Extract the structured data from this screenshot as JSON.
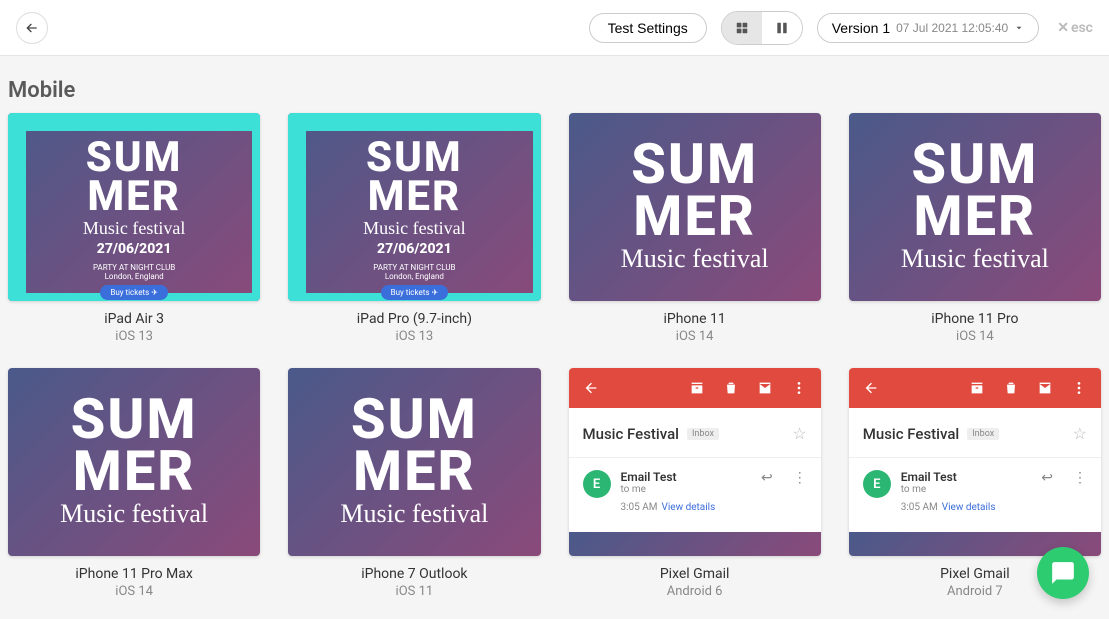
{
  "topbar": {
    "test_settings": "Test Settings",
    "version_label": "Version 1",
    "version_meta": "07 Jul 2021 12:05:40",
    "esc_label": "esc"
  },
  "section": {
    "title": "Mobile"
  },
  "poster": {
    "line1": "SUM",
    "line2": "MER",
    "festival": "Music festival",
    "date": "27/06/2021",
    "venue1": "PARTY AT NIGHT CLUB",
    "venue2": "London, England",
    "buy": "Buy tickets ✈"
  },
  "gmail": {
    "subject": "Music Festival",
    "label": "Inbox",
    "avatar_initial": "E",
    "sender": "Email Test",
    "to": "to me",
    "time": "3:05 AM",
    "view_details": "View details"
  },
  "cards": [
    {
      "type": "poster_cyan",
      "title": "iPad Air 3",
      "sub": "iOS 13"
    },
    {
      "type": "poster_cyan",
      "title": "iPad Pro (9.7-inch)",
      "sub": "iOS 13"
    },
    {
      "type": "poster_large",
      "title": "iPhone 11",
      "sub": "iOS 14"
    },
    {
      "type": "poster_large",
      "title": "iPhone 11 Pro",
      "sub": "iOS 14"
    },
    {
      "type": "poster_large",
      "title": "iPhone 11 Pro Max",
      "sub": "iOS 14"
    },
    {
      "type": "poster_large",
      "title": "iPhone 7 Outlook",
      "sub": "iOS 11"
    },
    {
      "type": "gmail",
      "title": "Pixel Gmail",
      "sub": "Android 6"
    },
    {
      "type": "gmail",
      "title": "Pixel Gmail",
      "sub": "Android 7"
    }
  ]
}
